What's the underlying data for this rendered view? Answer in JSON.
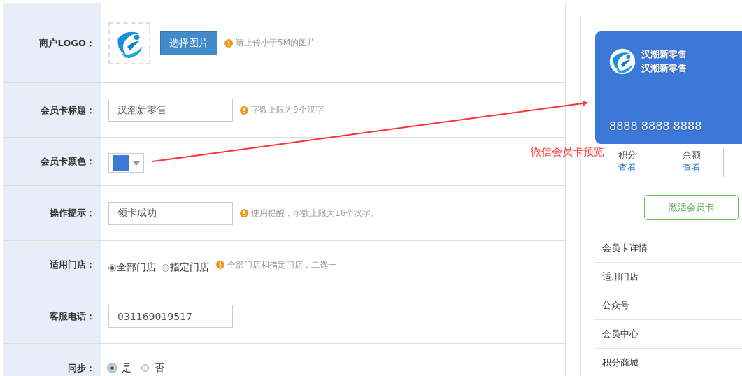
{
  "form": {
    "rows": [
      {
        "kind": "logo",
        "label": "商户LOGO：",
        "button": "选择图片",
        "hint": "请上传小于5M的图片"
      },
      {
        "kind": "text",
        "label": "会员卡标题：",
        "value": "汉潮新零售",
        "hint": "字数上限为9个汉字"
      },
      {
        "kind": "color",
        "label": "会员卡颜色：",
        "color": "#3c78d8"
      },
      {
        "kind": "text",
        "label": "操作提示：",
        "value": "领卡成功",
        "hint": "使用提醒，字数上限为16个汉字。"
      },
      {
        "kind": "radio",
        "label": "适用门店：",
        "options": [
          {
            "label": "全部门店",
            "selected": true
          },
          {
            "label": "指定门店",
            "selected": false
          }
        ],
        "hint": "全部门店和指定门店，二选一"
      },
      {
        "kind": "text",
        "label": "客服电话：",
        "value": "031169019517"
      },
      {
        "kind": "radio",
        "label": "同步：",
        "options": [
          {
            "label": "是",
            "selected": true
          },
          {
            "label": "否",
            "selected": false
          }
        ]
      }
    ]
  },
  "annotation": {
    "text": "微信会员卡预览"
  },
  "preview": {
    "card": {
      "name_lines": [
        "汉潮新零售",
        "汉潮新零售"
      ],
      "number": "8888 8888 8888"
    },
    "stats": [
      {
        "label": "积分",
        "link": "查看"
      },
      {
        "label": "余额",
        "link": "查看"
      }
    ],
    "activate_button": "激活会员卡",
    "menu": [
      "会员卡详情",
      "适用门店",
      "公众号",
      "会员中心",
      "积分商城"
    ]
  }
}
